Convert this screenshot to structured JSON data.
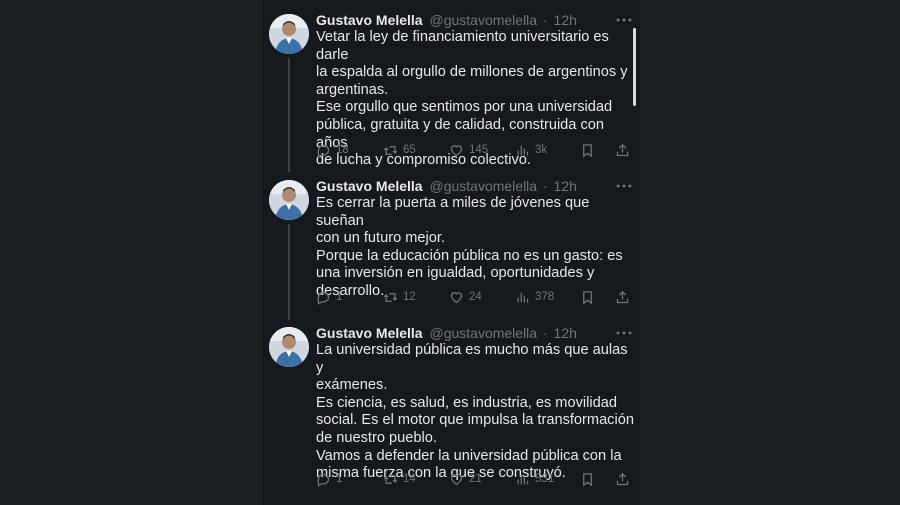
{
  "tweets": [
    {
      "author": {
        "name": "Gustavo Melella",
        "handle": "@gustavomelella",
        "sep": "·",
        "time": "12h"
      },
      "lines": [
        "Vetar la ley de financiamiento universitario es darle",
        "la espalda al orgullo de millones de argentinos y",
        "argentinas.",
        "Ese orgullo que sentimos por una universidad",
        "pública, gratuita y de calidad, construida con años",
        "de lucha y compromiso colectivo."
      ],
      "stats": {
        "replies": "18",
        "reposts": "65",
        "likes": "145",
        "views": "3k"
      }
    },
    {
      "author": {
        "name": "Gustavo Melella",
        "handle": "@gustavomelella",
        "sep": "·",
        "time": "12h"
      },
      "lines": [
        "Es cerrar la puerta a miles de jóvenes que sueñan",
        "con un futuro mejor.",
        "Porque la educación pública no es un gasto: es",
        "una inversión en igualdad, oportunidades y",
        "desarrollo."
      ],
      "stats": {
        "replies": "1",
        "reposts": "12",
        "likes": "24",
        "views": "378"
      }
    },
    {
      "author": {
        "name": "Gustavo Melella",
        "handle": "@gustavomelella",
        "sep": "·",
        "time": "12h"
      },
      "lines": [
        "La universidad pública es mucho más que aulas y",
        "exámenes.",
        "Es ciencia, es salud, es industria, es movilidad",
        "social. Es el motor que impulsa la transformación",
        "de nuestro pueblo.",
        "Vamos a defender la universidad pública con la",
        "misma fuerza con la que se construyó."
      ],
      "stats": {
        "replies": "1",
        "reposts": "14",
        "likes": "21",
        "views": "531"
      }
    }
  ],
  "icons": {
    "more": "more-horizontal-icon",
    "reply": "reply-bubble-icon",
    "repost": "repost-arrows-icon",
    "like": "heart-icon",
    "views": "views-bar-chart-icon",
    "bookmark": "bookmark-icon",
    "share": "share-upload-icon"
  },
  "colors": {
    "background": "#1b1f23",
    "panel": "#15181c",
    "text": "#e7e9ea",
    "secondary": "#71767b",
    "thread_line": "#3b4147"
  }
}
